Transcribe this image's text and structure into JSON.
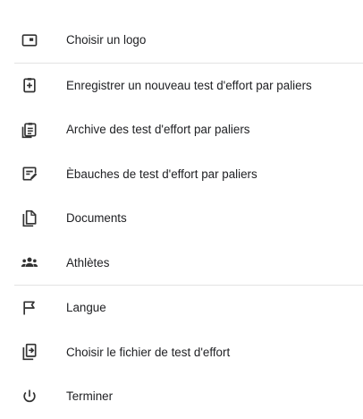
{
  "menu": {
    "items": [
      {
        "label": "Choisir un logo",
        "icon": "logo-icon"
      },
      {
        "label": "Enregistrer un nouveau test d'effort par paliers",
        "icon": "new-test-clipboard-icon"
      },
      {
        "label": "Archive des test d'effort par paliers",
        "icon": "archive-clipboard-icon"
      },
      {
        "label": "Èbauches de test d'effort par paliers",
        "icon": "draft-edit-icon"
      },
      {
        "label": "Documents",
        "icon": "documents-icon"
      },
      {
        "label": "Athlètes",
        "icon": "athletes-group-icon"
      },
      {
        "label": "Langue",
        "icon": "flag-icon"
      },
      {
        "label": "Choisir le fichier de test d'effort",
        "icon": "file-select-icon"
      },
      {
        "label": "Terminer",
        "icon": "power-icon"
      }
    ]
  }
}
